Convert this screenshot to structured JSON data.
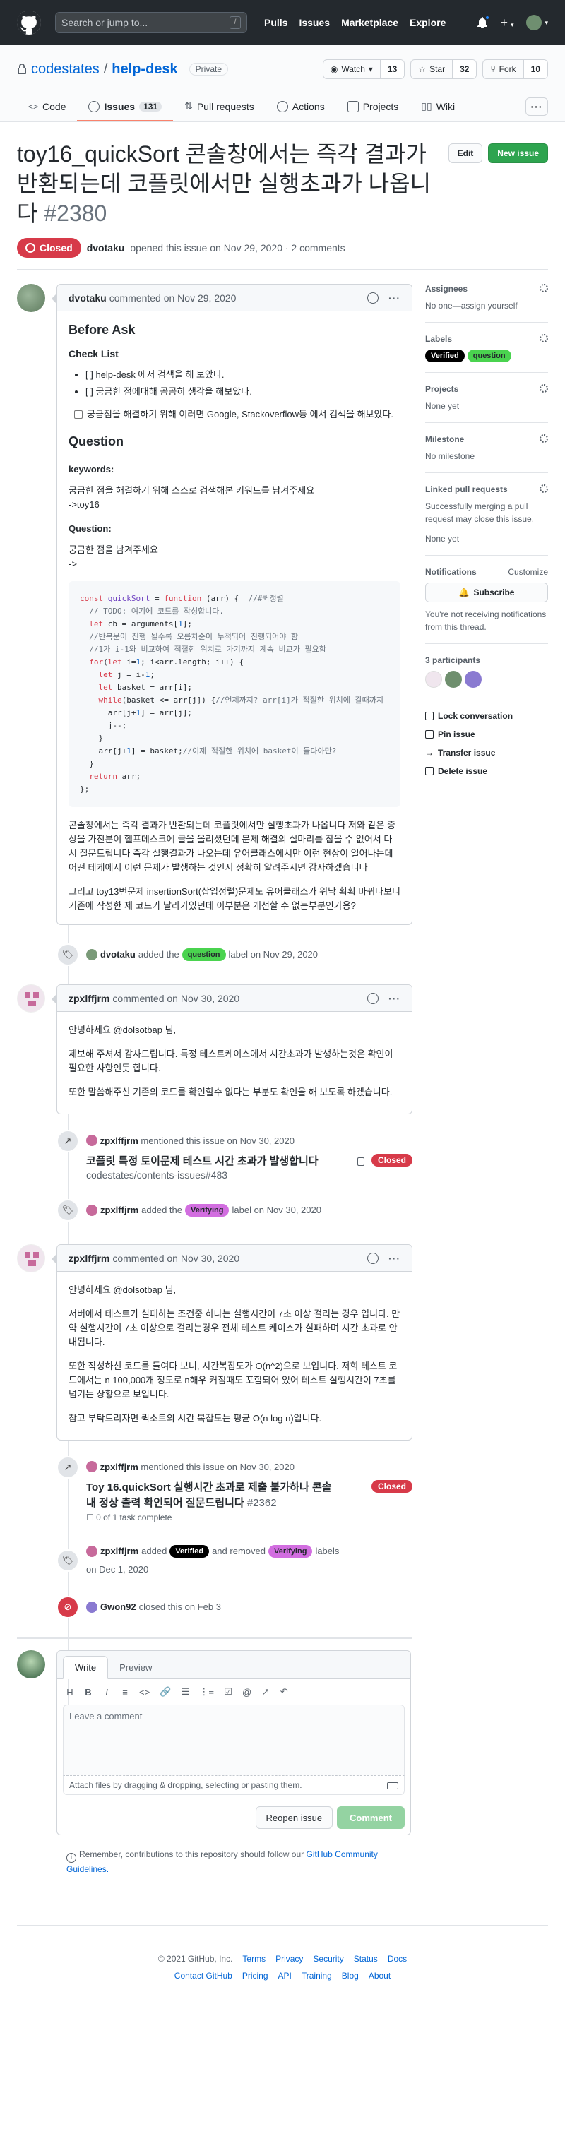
{
  "header": {
    "search_placeholder": "Search or jump to...",
    "search_key": "/",
    "nav": [
      "Pulls",
      "Issues",
      "Marketplace",
      "Explore"
    ]
  },
  "repo": {
    "owner": "codestates",
    "name": "help-desk",
    "visibility": "Private",
    "watch": {
      "label": "Watch",
      "count": "13"
    },
    "star": {
      "label": "Star",
      "count": "32"
    },
    "fork": {
      "label": "Fork",
      "count": "10"
    },
    "tabs": [
      {
        "label": "Code"
      },
      {
        "label": "Issues",
        "count": "131"
      },
      {
        "label": "Pull requests"
      },
      {
        "label": "Actions"
      },
      {
        "label": "Projects"
      },
      {
        "label": "Wiki"
      }
    ]
  },
  "issue": {
    "title": "toy16_quickSort 콘솔창에서는 즉각 결과가 반환되는데 코플릿에서만 실행초과가 나옵니다",
    "number": "#2380",
    "edit_label": "Edit",
    "new_issue_label": "New issue",
    "state": "Closed",
    "author": "dvotaku",
    "meta": "opened this issue on Nov 29, 2020 · 2 comments"
  },
  "comment1": {
    "author": "dvotaku",
    "date": "commented on Nov 29, 2020",
    "h_before": "Before Ask",
    "h_checklist": "Check List",
    "checklist": [
      "[ ] help-desk 에서 검색을 해 보았다.",
      "[ ] 궁금한 점에대해 곰곰히 생각을 해보았다."
    ],
    "task": "궁금점을 해결하기 위해 이러면 Google, Stackoverflow등 에서 검색을 해보았다.",
    "h_question": "Question",
    "keywords_label": "keywords:",
    "keywords_desc": "궁금한 점을 해결하기 위해 스스로 검색해본 키워드를 남겨주세요",
    "keywords_val": "->toy16",
    "question_label": "Question:",
    "question_desc": "궁금한 점을 남겨주세요",
    "question_val": "->",
    "code": [
      "const quickSort = function (arr) {  //#퀵정렬",
      "  // TODO: 여기에 코드를 작성합니다.",
      "  let cb = arguments[1];",
      "  //반복문이 진행 될수록 오름차순이 누적되어 진행되어야 함",
      "  //1가 i-1와 비교하여 적절한 위치로 가기까지 계속 비교가 필요함",
      "  for(let i=1; i<arr.length; i++) {",
      "    let j = i-1;",
      "    let basket = arr[i];",
      "    while(basket <= arr[j]) {//언제까지? arr[i]가 적절한 위치에 갈때까지",
      "      arr[j+1] = arr[j];",
      "      j--;",
      "    }",
      "    arr[j+1] = basket;//이제 적절한 위치에 basket이 들다아만?",
      "  }",
      "  return arr;",
      "};"
    ],
    "para1": "콘솔창에서는 즉각 결과가 반환되는데 코플릿에서만 실행초과가 나옵니다 저와 같은 증상을 가진분이 헬프데스크에 글을 올리셨던데 문제 해결의 실마리를 잡을 수 없어서 다시 질문드립니다 즉각 실행결과가 나오는데 유어클래스에서만 이런 현상이 일어나는데 어떤 테케에서 이런 문제가 발생하는 것인지 정확히 알려주시면 감사하겠습니다",
    "para2": "그리고 toy13번문제 insertionSort(삽입정렬)문제도 유어클래스가 워낙 획획 바뀌다보니 기존에 작성한 제 코드가 날라가있던데 이부분은 개선할 수 없는부분인가용?"
  },
  "event1": {
    "actor": "dvotaku",
    "pre": "added the",
    "label": "question",
    "post": "label on Nov 29, 2020"
  },
  "comment2": {
    "author": "zpxlffjrm",
    "date": "commented on Nov 30, 2020",
    "p1": "안녕하세요 @dolsotbap 님,",
    "p2": "제보해 주셔서 감사드립니다. 특정 테스트케이스에서 시간초과가 발생하는것은 확인이 필요한 사항인듯 합니다.",
    "p3": "또한 말씀해주신 기존의 코드를 확인할수 없다는 부분도 확인을 해 보도록 하겠습니다."
  },
  "ref1": {
    "actor": "zpxlffjrm",
    "text": "mentioned this issue on Nov 30, 2020",
    "title": "코플릿 특정 토이문제 테스트 시간 초과가 발생합니다",
    "sub": "codestates/contents-issues#483",
    "state": "Closed"
  },
  "event2": {
    "actor": "zpxlffjrm",
    "pre": "added the",
    "label": "Verifying",
    "post": "label on Nov 30, 2020"
  },
  "comment3": {
    "author": "zpxlffjrm",
    "date": "commented on Nov 30, 2020",
    "p1": "안녕하세요 @dolsotbap 님,",
    "p2": "서버에서 테스트가 실패하는 조건중 하나는 실행시간이 7초 이상 걸리는 경우 입니다. 만약 실행시간이 7초 이상으로 걸리는경우 전체 테스트 케이스가 실패하며 시간 초과로 안내됩니다.",
    "p3": "또한 작성하신 코드를 들여다 보니, 시간복잡도가 O(n^2)으로 보입니다. 저희 테스트 코드에서는 n 100,000개 정도로 n해우 커짐때도 포함되어 있어 테스트 실행시간이 7초를 넘기는 상황으로 보입니다.",
    "p4": "참고 부탁드리자면 퀵소트의 시간 복잡도는 평균 O(n log n)입니다."
  },
  "ref2": {
    "actor": "zpxlffjrm",
    "text": "mentioned this issue on Nov 30, 2020",
    "title": "Toy 16.quickSort 실행시간 초과로 제출 불가하나 콘솔 내 정상 출력 확인되어 질문드립니다",
    "num": "#2362",
    "tasks": "0 of 1 task complete",
    "state": "Closed"
  },
  "event3": {
    "actor": "zpxlffjrm",
    "pre": "added",
    "label1": "Verified",
    "mid": "and removed",
    "label2": "Verifying",
    "post": "labels",
    "date": "on Dec 1, 2020"
  },
  "event4": {
    "actor": "Gwon92",
    "text": "closed this on Feb 3"
  },
  "new_comment": {
    "tab_write": "Write",
    "tab_preview": "Preview",
    "toolbar": [
      "H",
      "B",
      "I",
      "≡",
      "<>",
      "🔗",
      "☰",
      "⋮≡",
      "☑",
      "@",
      "↗",
      "↶"
    ],
    "placeholder": "Leave a comment",
    "attach": "Attach files by dragging & dropping, selecting or pasting them.",
    "reopen": "Reopen issue",
    "comment": "Comment",
    "remember": "Remember, contributions to this repository should follow our",
    "guidelines": "GitHub Community Guidelines."
  },
  "sidebar": {
    "assignees_h": "Assignees",
    "assignees": "No one—assign yourself",
    "labels_h": "Labels",
    "labels": [
      {
        "name": "Verified",
        "bg": "#000000",
        "fg": "#ffffff"
      },
      {
        "name": "question",
        "bg": "#4ad34f",
        "fg": "#24292e"
      }
    ],
    "projects_h": "Projects",
    "projects": "None yet",
    "milestone_h": "Milestone",
    "milestone": "No milestone",
    "linked_h": "Linked pull requests",
    "linked": "Successfully merging a pull request may close this issue.",
    "linked_none": "None yet",
    "notif_h": "Notifications",
    "customize": "Customize",
    "subscribe": "Subscribe",
    "notif_txt": "You're not receiving notifications from this thread.",
    "participants_h": "3 participants",
    "actions": [
      "Lock conversation",
      "Pin issue",
      "Transfer issue",
      "Delete issue"
    ]
  },
  "footer": {
    "row1": [
      "© 2021 GitHub, Inc.",
      "Terms",
      "Privacy",
      "Security",
      "Status",
      "Docs"
    ],
    "row2": [
      "Contact GitHub",
      "Pricing",
      "API",
      "Training",
      "Blog",
      "About"
    ]
  },
  "colors": {
    "question": "#4ad34f",
    "verifying": "#d26ee0",
    "verified": "#000000",
    "closed": "#d73a49"
  }
}
